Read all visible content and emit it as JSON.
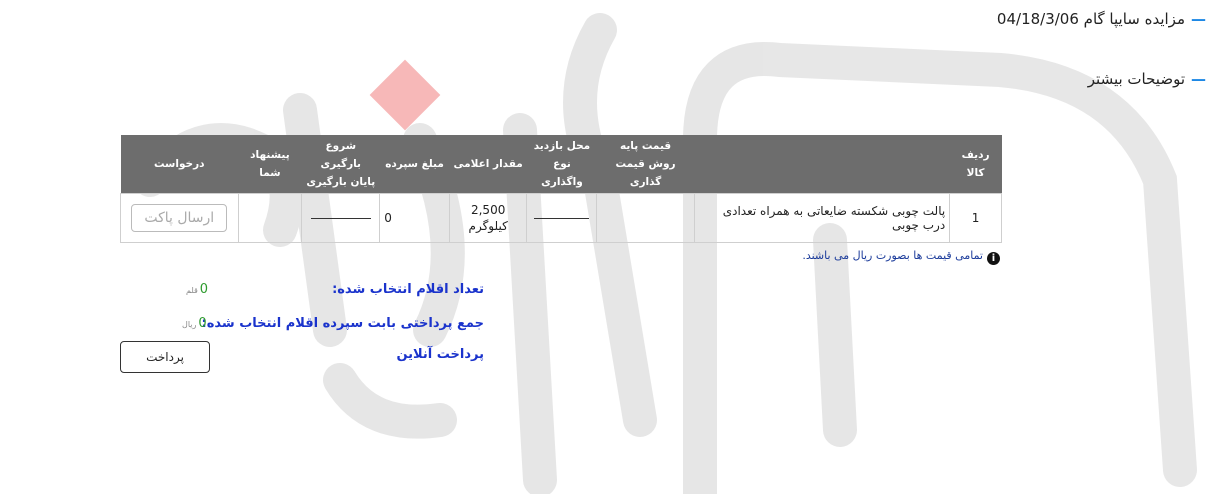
{
  "header": {
    "auction_label": "مزایده سایپا گام 04/18/3/06",
    "more_details_label": "توضیحات بیشتر"
  },
  "table": {
    "col_row_item": "ردیف کالا",
    "col_base_price": "قیمت پایه",
    "col_price_method": "روش قیمت گذاری",
    "col_visit_place": "محل بازدید",
    "col_transfer_type": "نوع واگذاری",
    "col_announced_qty": "مقدار اعلامی",
    "col_deposit": "مبلغ سپرده",
    "col_load_start": "شروع بارگیری",
    "col_load_end": "پایان بارگیری",
    "col_your_offer": "پیشنهاد شما",
    "col_request": "درخواست",
    "rows": [
      {
        "row_no": "1",
        "item": "پالت چوبی شکسته ضایعاتی به همراه تعدادی درب چوبی",
        "qty": "2,500",
        "unit": "کیلوگرم",
        "deposit": "0",
        "send_label": "ارسال پاکت"
      }
    ]
  },
  "note": "تمامی قیمت ها بصورت ریال می باشند.",
  "summary": {
    "selected_label": "تعداد اقلام انتخاب شده:",
    "selected_value": "0",
    "selected_unit": "قلم",
    "payment_label": "جمع پرداختی بابت سپرده اقلام انتخاب شده:",
    "payment_value": "0",
    "payment_unit": "ریال",
    "online_label": "پرداخت آنلاین"
  },
  "pay_button_label": "پرداخت",
  "colors": {
    "accent": "#1e88e5",
    "header_bg": "#6d6d6d",
    "link_blue": "#1a33cc",
    "green": "#2e9b2e"
  }
}
